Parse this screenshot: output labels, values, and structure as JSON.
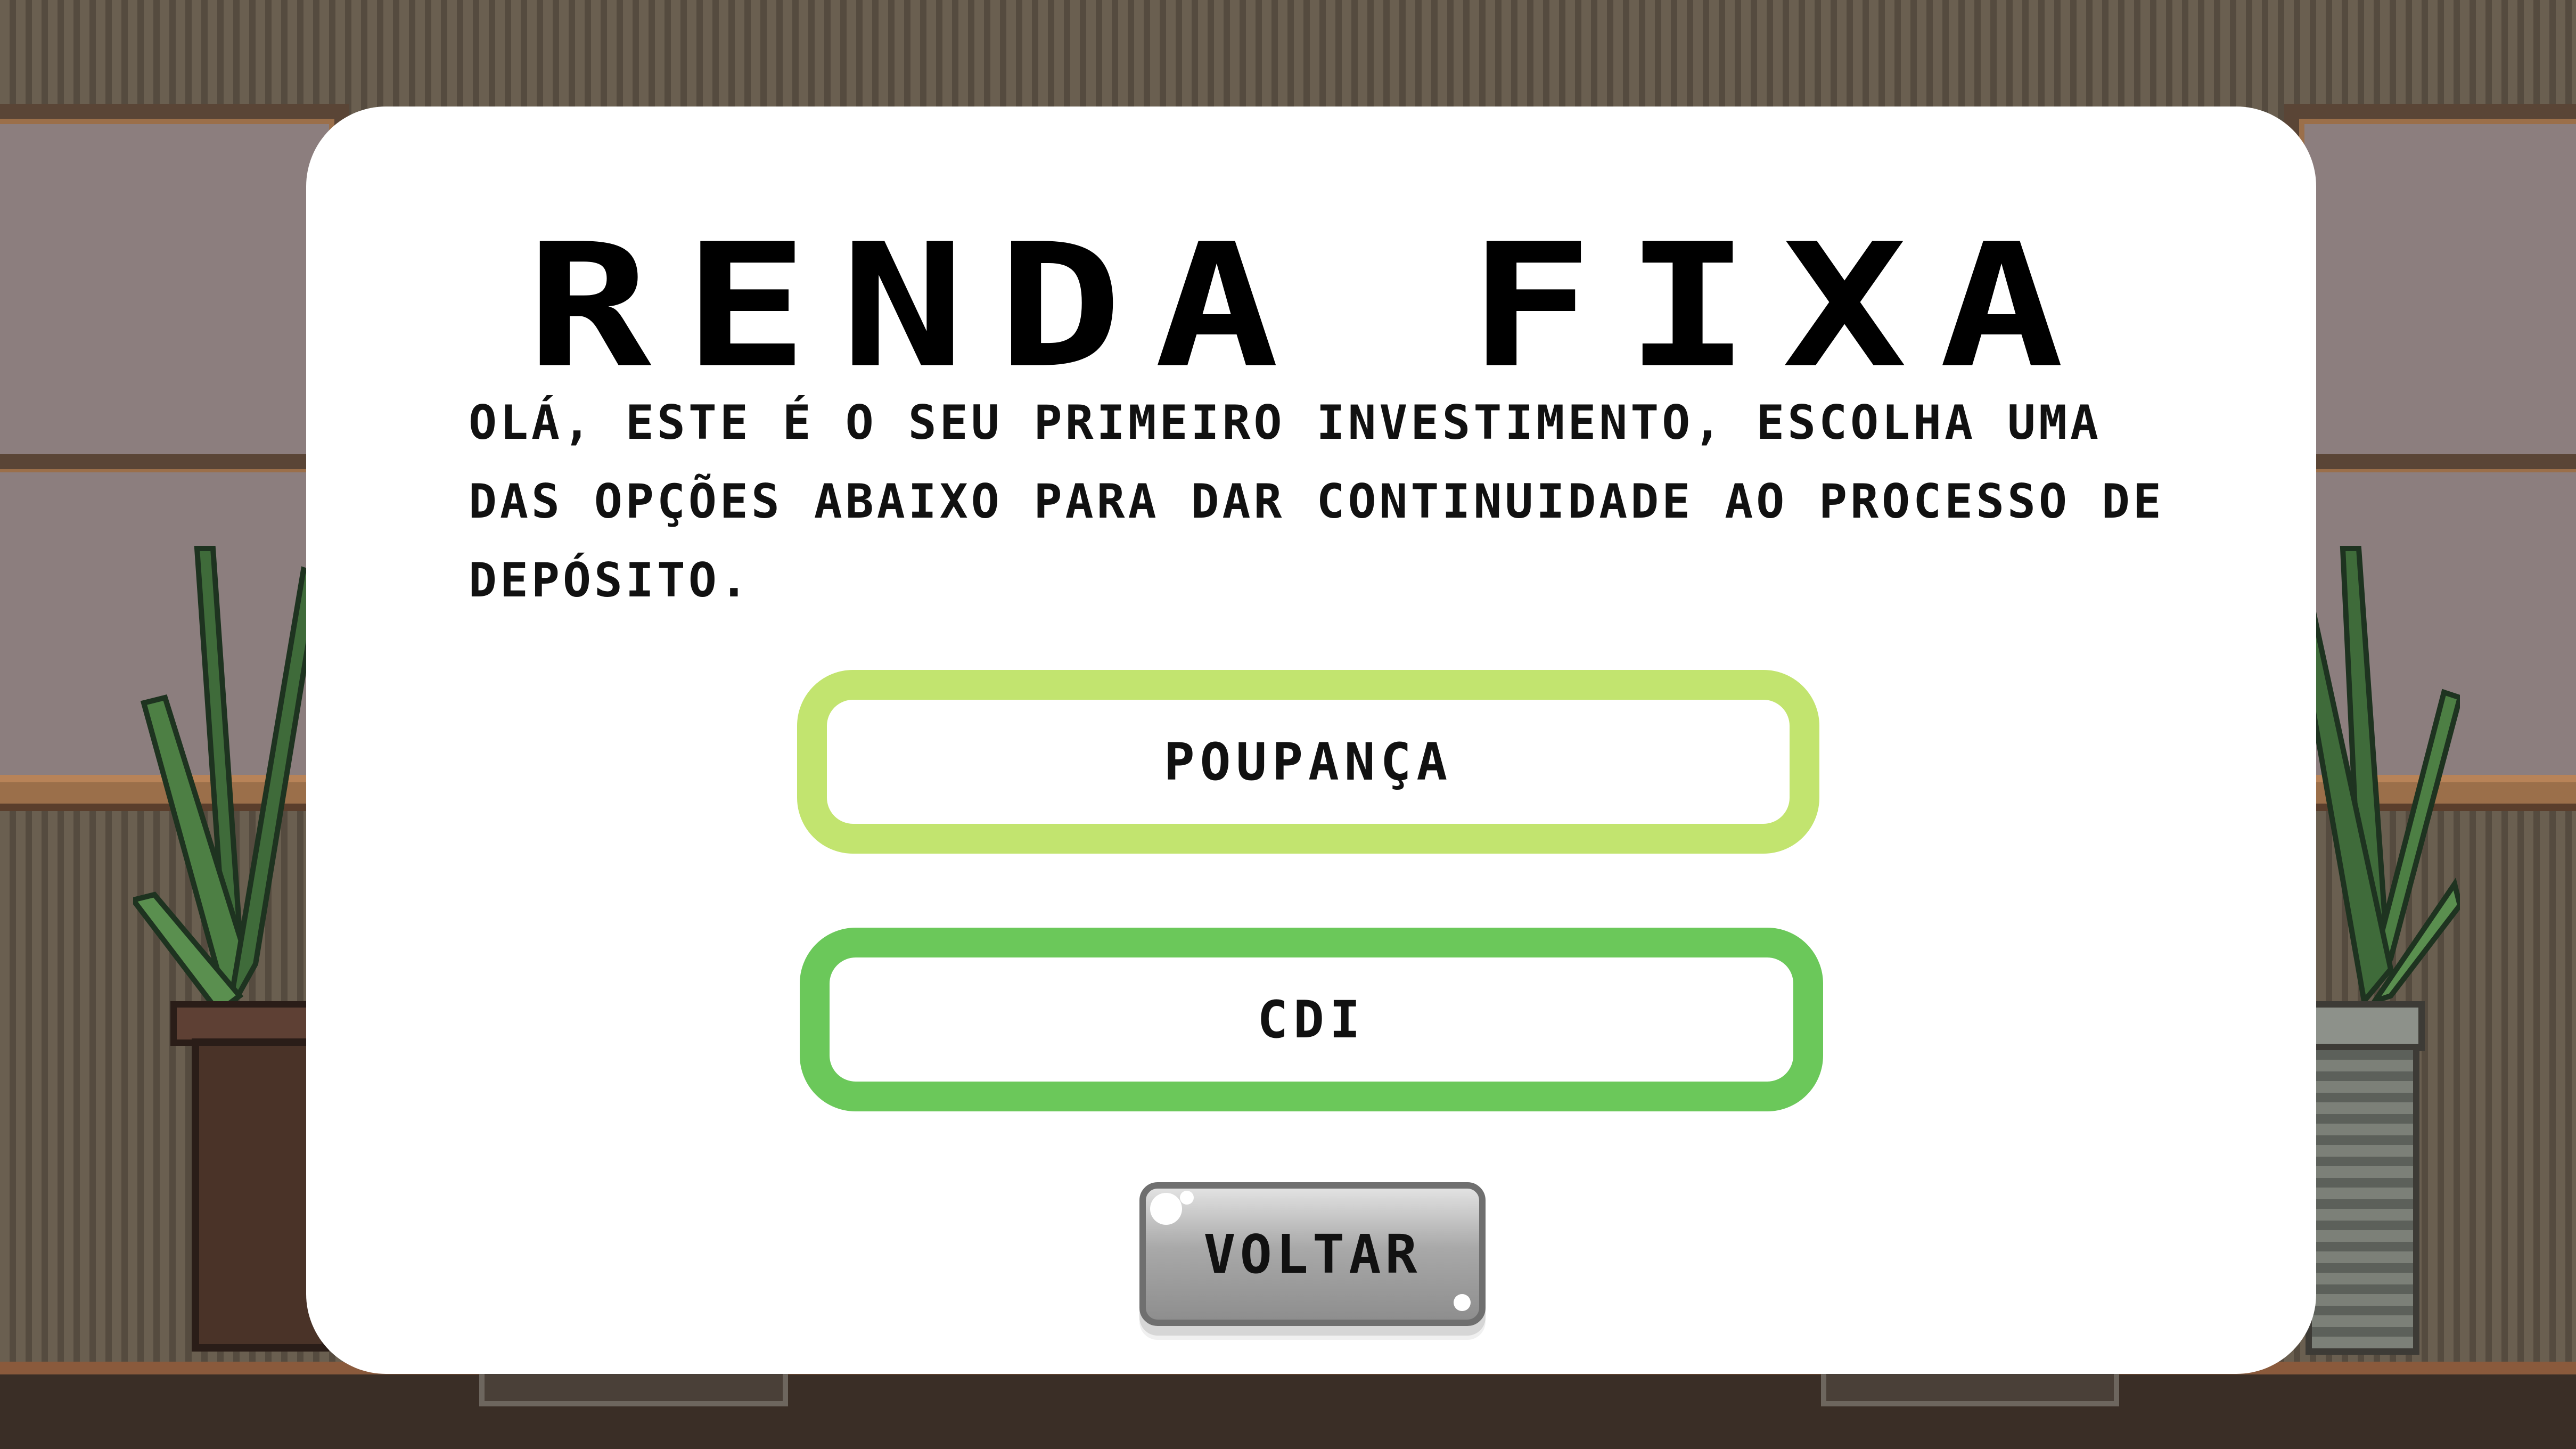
{
  "modal": {
    "title": "RENDA FIXA",
    "description": "OLÁ, ESTE É O SEU PRIMEIRO INVESTIMENTO, ESCOLHA UMA DAS OPÇÕES ABAIXO PARA DAR CONTINUIDADE AO PROCESSO DE DEPÓSITO.",
    "options": [
      {
        "label": "POUPANÇA",
        "border_color": "#c2e46f"
      },
      {
        "label": "CDI",
        "border_color": "#6bc85a"
      }
    ],
    "back_label": "VOLTAR"
  },
  "colors": {
    "modal_background": "#ffffff",
    "wall": "#6a5f50",
    "plant": "#3f6b3a"
  }
}
